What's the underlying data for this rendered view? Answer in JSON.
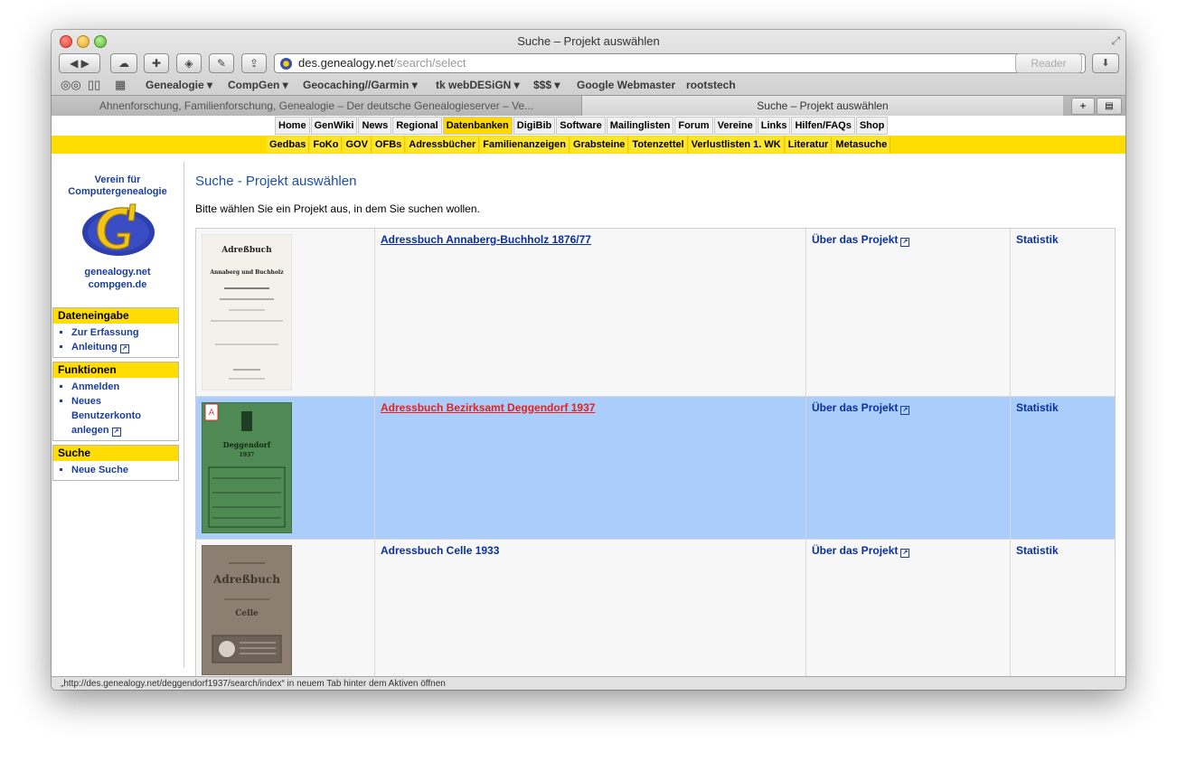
{
  "window": {
    "title": "Suche – Projekt auswählen"
  },
  "address": {
    "host": "des.genealogy.net",
    "path": "/search/select",
    "reader_label": "Reader"
  },
  "bookmarks": [
    {
      "label": "Genealogie ▾"
    },
    {
      "label": "CompGen ▾"
    },
    {
      "label": "Geocaching//Garmin ▾"
    },
    {
      "label": "tk webDESiGN ▾"
    },
    {
      "label": "$$$ ▾"
    },
    {
      "label": "Google Webmaster"
    },
    {
      "label": "rootstech"
    }
  ],
  "tabs": [
    {
      "label": "Ahnenforschung, Familienforschung, Genealogie – Der deutsche Genealogieserver – Ve..."
    },
    {
      "label": "Suche – Projekt auswählen"
    }
  ],
  "nav_primary": [
    "Home",
    "GenWiki",
    "News",
    "Regional",
    "Datenbanken",
    "DigiBib",
    "Software",
    "Mailinglisten",
    "Forum",
    "Vereine",
    "Links",
    "Hilfen/FAQs",
    "Shop"
  ],
  "nav_primary_selected": "Datenbanken",
  "nav_secondary": [
    "Gedbas",
    "FoKo",
    "GOV",
    "OFBs",
    "Adressbücher",
    "Familienanzeigen",
    "Grabsteine",
    "Totenzettel",
    "Verlustlisten 1. WK",
    "Literatur",
    "Metasuche"
  ],
  "sidebar": {
    "org_line1": "Verein für",
    "org_line2": "Computergenealogie",
    "site1": "genealogy.net",
    "site2": "compgen.de",
    "boxes": [
      {
        "title": "Dateneingabe",
        "items": [
          "Zur Erfassung",
          "Anleitung"
        ]
      },
      {
        "title": "Funktionen",
        "items": [
          "Anmelden",
          "Neues Benutzerkonto anlegen"
        ]
      },
      {
        "title": "Suche",
        "items": [
          "Neue Suche"
        ]
      }
    ]
  },
  "page": {
    "title": "Suche - Projekt auswählen",
    "intro": "Bitte wählen Sie ein Projekt aus, in dem Sie suchen wollen."
  },
  "projects": [
    {
      "name": "Adressbuch Annaberg-Buchholz 1876/77",
      "about": "Über das Projekt",
      "stats": "Statistik",
      "cover_title": "Adreßbuch",
      "cover_sub": "Annaberg und Buchholz"
    },
    {
      "name": "Adressbuch Bezirksamt Deggendorf 1937",
      "about": "Über das Projekt",
      "stats": "Statistik",
      "cover_title": "Deggendorf",
      "cover_sub": "1937"
    },
    {
      "name": "Adressbuch Celle 1933",
      "about": "Über das Projekt",
      "stats": "Statistik",
      "cover_title": "Adreßbuch",
      "cover_sub": "Celle"
    }
  ],
  "statusbar": {
    "text": "„http://des.genealogy.net/deggendorf1937/search/index“ in neuem Tab hinter dem Aktiven öffnen"
  }
}
